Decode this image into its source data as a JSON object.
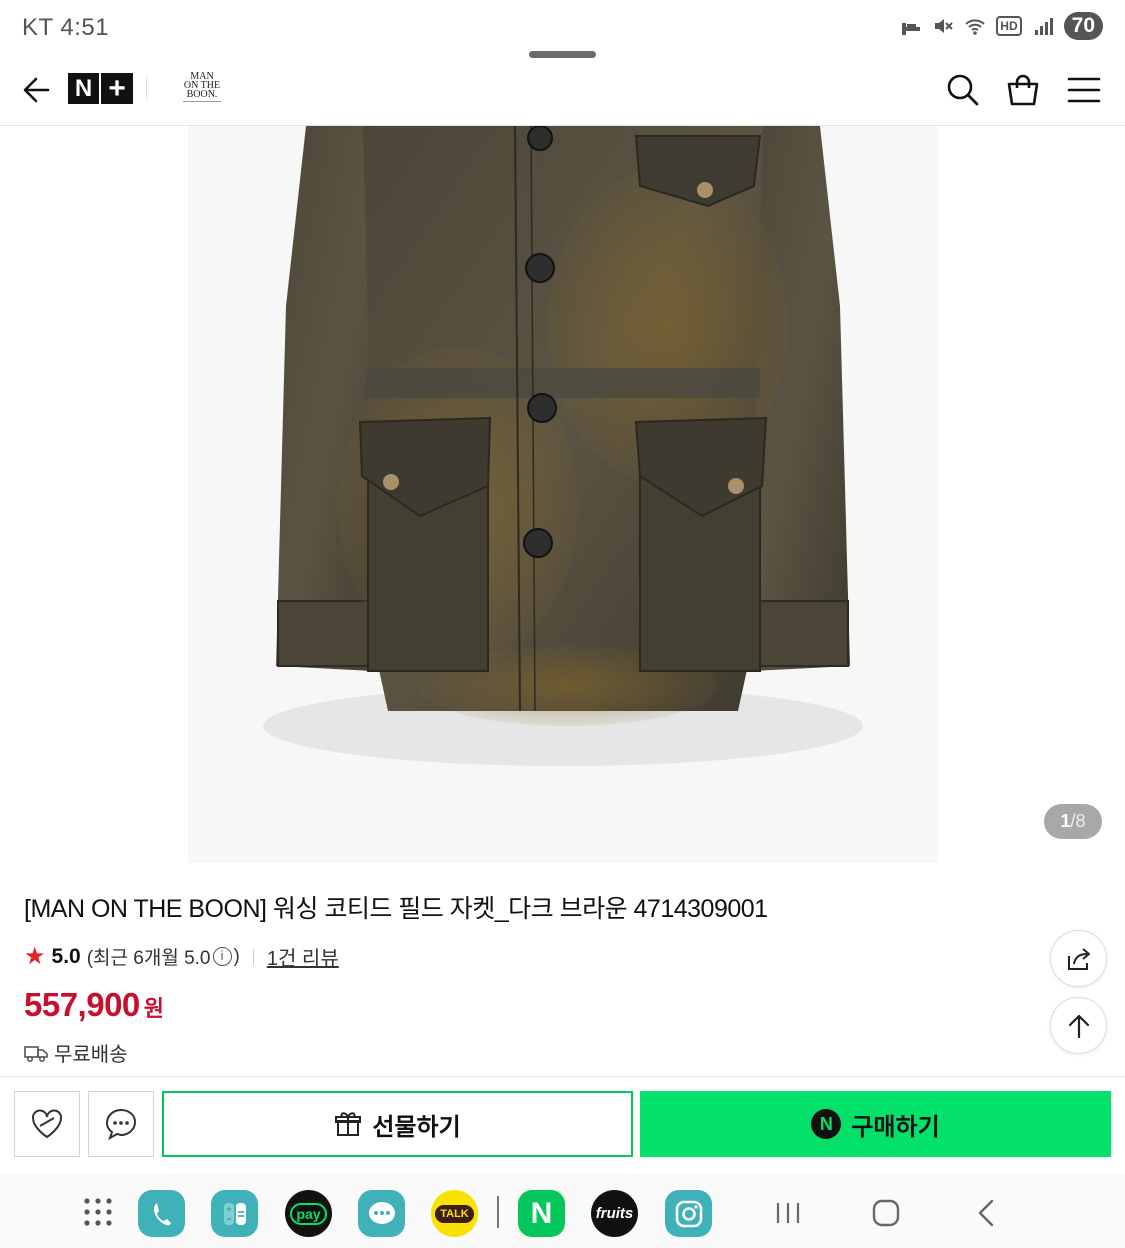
{
  "status_bar": {
    "carrier_time": "KT 4:51",
    "hd_label": "HD",
    "battery": "70"
  },
  "header": {
    "nplus_n": "N",
    "nplus_plus": "+",
    "brand_logo_lines": [
      "MAN",
      "ON THE",
      "BOON."
    ]
  },
  "gallery": {
    "current": "1",
    "separator": "/",
    "total": "8"
  },
  "product": {
    "title": "[MAN ON THE BOON] 워싱 코티드 필드 자켓_다크 브라운 4714309001",
    "rating_score": "5.0",
    "rating_recent_prefix": "(최근 6개월 5.0",
    "rating_info_symbol": "i",
    "rating_recent_suffix": ")",
    "review_link": "1건 리뷰",
    "price": "557,900",
    "price_unit": "원",
    "delivery": "무료배송"
  },
  "actions": {
    "gift_label": "선물하기",
    "buy_badge": "N",
    "buy_label": "구매하기"
  },
  "navbar": {
    "pay_label": "pay",
    "talk_label": "TALK",
    "naver_label": "N",
    "fruits_label": "fruits"
  },
  "colors": {
    "price_red": "#c8102e",
    "star_red": "#e52226",
    "naver_green": "#03c75a",
    "buy_green": "#03e16b"
  }
}
